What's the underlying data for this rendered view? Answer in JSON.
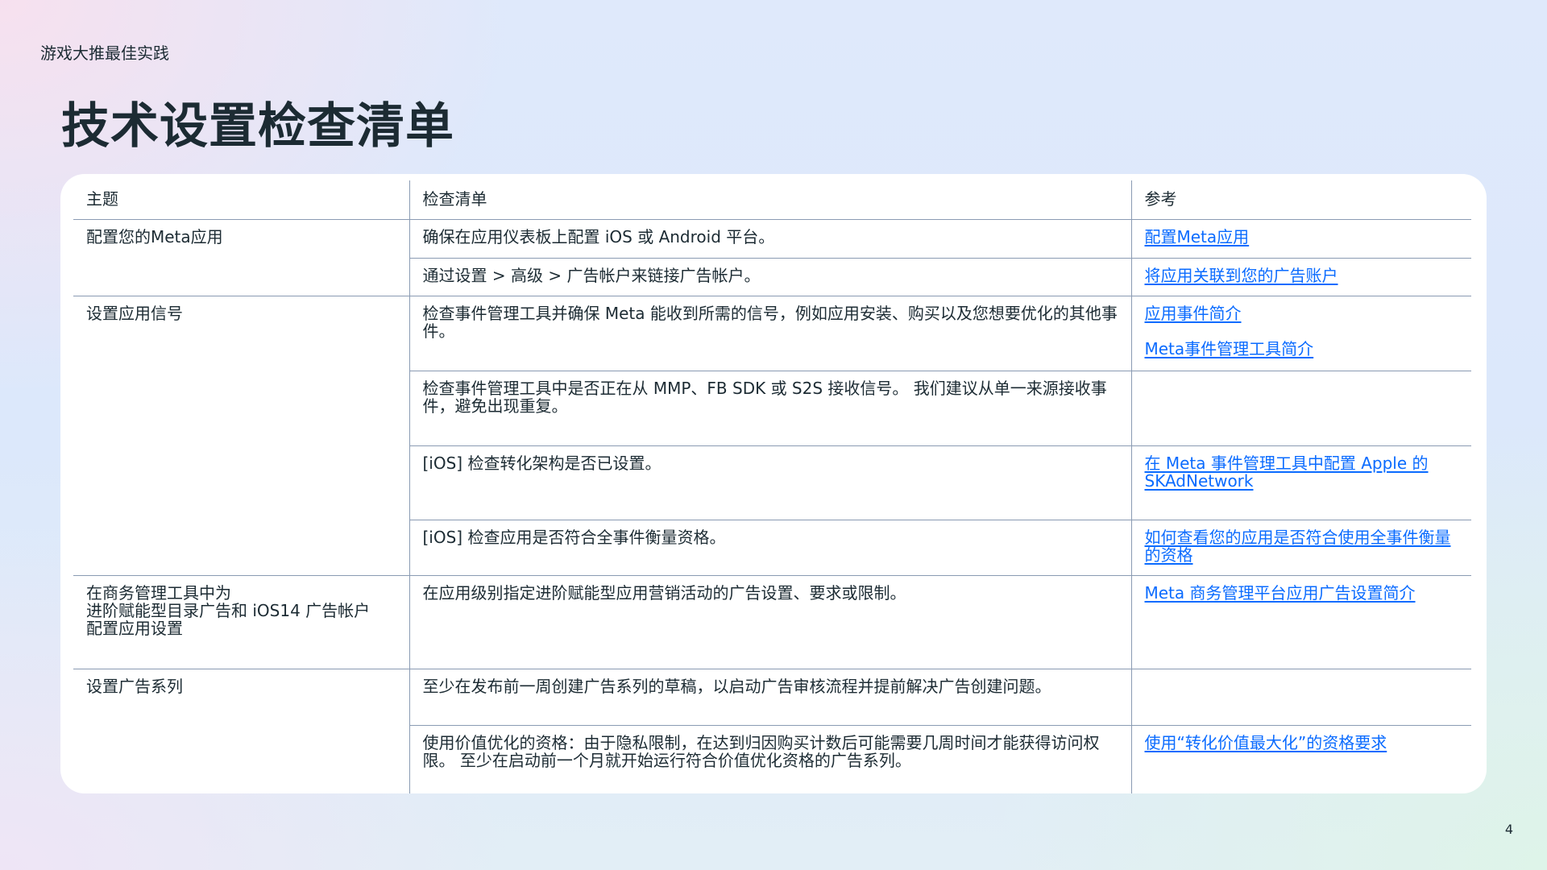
{
  "header": {
    "top_label": "游戏大推最佳实践",
    "title": "技术设置检查清单"
  },
  "table": {
    "columns": [
      "主题",
      "检查清单",
      "参考"
    ],
    "rows": [
      {
        "topic": "配置您的Meta应用",
        "check": "确保在应用仪表板上配置 iOS 或 Android 平台。",
        "refs": [
          "配置Meta应用"
        ]
      },
      {
        "topic": "",
        "check": "通过设置 > 高级 > 广告帐户来链接广告帐户。",
        "refs": [
          "将应用关联到您的广告账户"
        ]
      },
      {
        "topic": "设置应用信号",
        "check": "检查事件管理工具并确保 Meta 能收到所需的信号，例如应用安装、购买以及您想要优化的其他事件。",
        "refs": [
          "应用事件简介",
          "Meta事件管理工具简介"
        ]
      },
      {
        "topic": "",
        "check": "检查事件管理工具中是否正在从 MMP、FB SDK 或 S2S 接收信号。 我们建议从单一来源接收事件，避免出现重复。",
        "refs": []
      },
      {
        "topic": "",
        "check": "[iOS] 检查转化架构是否已设置。",
        "refs": [
          "在 Meta 事件管理工具中配置 Apple 的 SKAdNetwork"
        ]
      },
      {
        "topic": "",
        "check": "[iOS] 检查应用是否符合全事件衡量资格。",
        "refs": [
          "如何查看您的应用是否符合使用全事件衡量的资格"
        ]
      },
      {
        "topic": "在商务管理工具中为\n进阶赋能型目录广告和 iOS14 广告帐户\n配置应用设置",
        "check": "在应用级别指定进阶赋能型应用营销活动的广告设置、要求或限制。",
        "refs": [
          "Meta 商务管理平台应用广告设置简介"
        ]
      },
      {
        "topic": "设置广告系列",
        "check": "至少在发布前一周创建广告系列的草稿，以启动广告审核流程并提前解决广告创建问题。",
        "refs": []
      },
      {
        "topic": "",
        "check": "使用价值优化的资格：由于隐私限制，在达到归因购买计数后可能需要几周时间才能获得访问权限。 至少在启动前一个月就开始运行符合价值优化资格的广告系列。",
        "refs": [
          "使用“转化价值最大化”的资格要求"
        ]
      }
    ]
  },
  "footer": {
    "page_number": "4"
  }
}
